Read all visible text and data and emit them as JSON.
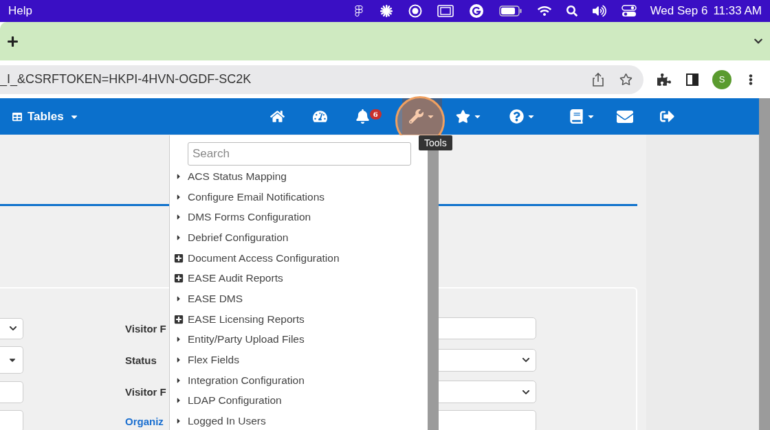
{
  "menubar": {
    "app_menu": "Help",
    "date": "Wed Sep 6",
    "time": "11:33 AM"
  },
  "address_bar": {
    "url": "_I_&CSRFTOKEN=HKPI-4HVN-OGDF-SC2K",
    "avatar": "S"
  },
  "navbar": {
    "tables_label": "Tables",
    "items": [
      {
        "selected": false,
        "has_menu": false
      },
      {
        "selected": false,
        "has_menu": false
      },
      {
        "selected": false,
        "has_menu": false,
        "badge": "6"
      },
      {
        "selected": true,
        "has_menu": true
      },
      {
        "selected": false,
        "has_menu": true
      },
      {
        "selected": false,
        "has_menu": true
      },
      {
        "selected": false,
        "has_menu": true
      },
      {
        "selected": false,
        "has_menu": false
      },
      {
        "selected": false,
        "has_menu": false
      }
    ]
  },
  "tooltip": "Tools",
  "tools_menu": {
    "search_placeholder": "Search",
    "items": [
      {
        "label": "ACS Status Mapping",
        "kind": "leaf"
      },
      {
        "label": "Configure Email Notifications",
        "kind": "leaf"
      },
      {
        "label": "DMS Forms Configuration",
        "kind": "leaf"
      },
      {
        "label": "Debrief Configuration",
        "kind": "leaf"
      },
      {
        "label": "Document Access Configuration",
        "kind": "group"
      },
      {
        "label": "EASE Audit Reports",
        "kind": "group"
      },
      {
        "label": "EASE DMS",
        "kind": "leaf"
      },
      {
        "label": "EASE Licensing Reports",
        "kind": "group"
      },
      {
        "label": "Entity/Party Upload Files",
        "kind": "leaf"
      },
      {
        "label": "Flex Fields",
        "kind": "leaf"
      },
      {
        "label": "Integration Configuration",
        "kind": "leaf"
      },
      {
        "label": "LDAP Configuration",
        "kind": "leaf"
      },
      {
        "label": "Logged In Users",
        "kind": "leaf"
      }
    ]
  },
  "form": {
    "rows": [
      {
        "label": {
          "text": "Visitor F",
          "kind": "plain"
        },
        "left_field": {
          "kind": "select"
        },
        "right_field": {
          "kind": "input"
        }
      },
      {
        "label": {
          "text": "Status",
          "kind": "plain"
        },
        "left_field": {
          "kind": "split"
        },
        "right_field": {
          "kind": "select"
        }
      },
      {
        "label": {
          "text": "Visitor F",
          "kind": "plain"
        },
        "left_field": {
          "kind": "input"
        },
        "right_field": {
          "kind": "select"
        }
      },
      {
        "label": {
          "text": "Organiz",
          "kind": "link"
        },
        "left_field": {
          "kind": "input"
        },
        "right_field": {
          "kind": "input"
        }
      }
    ]
  }
}
